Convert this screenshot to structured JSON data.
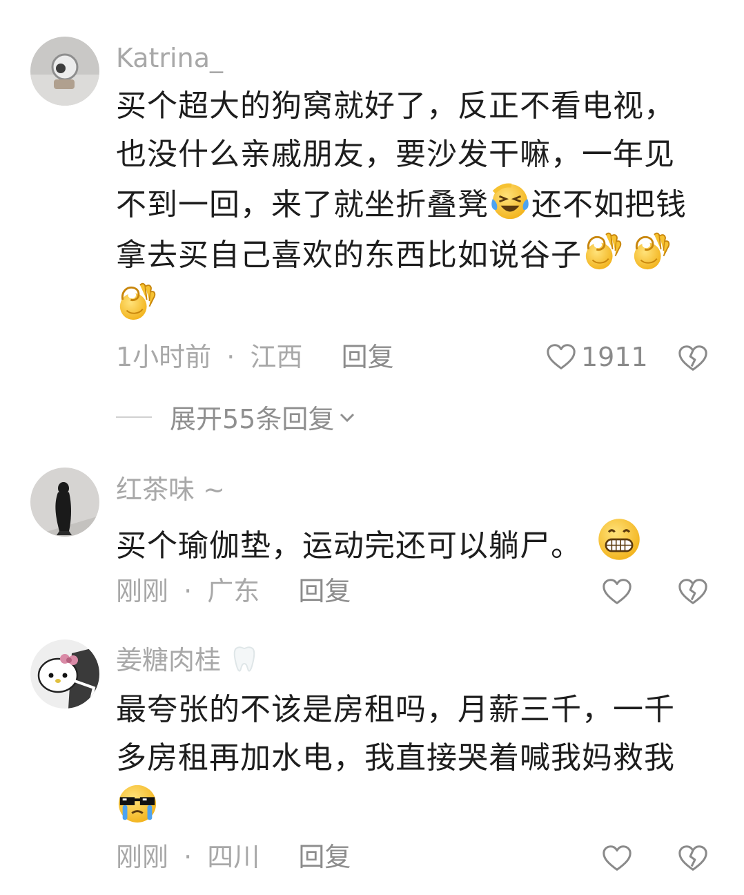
{
  "comments": [
    {
      "username": "Katrina_",
      "text_lines": [
        "买个超大的狗窝就好了，反正不看电视，",
        "也没什么亲戚朋友，要沙发干嘛，一年见",
        "不到一回，来了就坐折叠凳",
        "还不如把钱",
        "拿去买自己喜欢的东西比如说谷子"
      ],
      "emojis": [
        "laughing-crying-emoji",
        "ok-hand-emoji"
      ],
      "time": "1小时前",
      "location": "江西",
      "separator": "·",
      "reply_label": "回复",
      "like_count": "1911",
      "expand_label": "展开55条回复"
    },
    {
      "username": "红茶味 ~",
      "text": "买个瑜伽垫，运动完还可以躺尸。",
      "emojis": [
        "grinning-emoji"
      ],
      "time": "刚刚",
      "location": "广东",
      "separator": "·",
      "reply_label": "回复"
    },
    {
      "username": "姜糖肉桂",
      "text_lines": [
        "最夸张的不该是房租吗，月薪三千，一千",
        "多房租再加水电，我直接哭着喊我妈救我"
      ],
      "emojis": [
        "crying-sunglasses-emoji",
        "tooth-emoji"
      ],
      "time": "刚刚",
      "location": "四川",
      "separator": "·",
      "reply_label": "回复"
    }
  ],
  "colors": {
    "text": "#1d1d1d",
    "meta": "#a8a8a8",
    "icon": "#8a8a8a",
    "emoji_yellow": "#f7c531"
  }
}
